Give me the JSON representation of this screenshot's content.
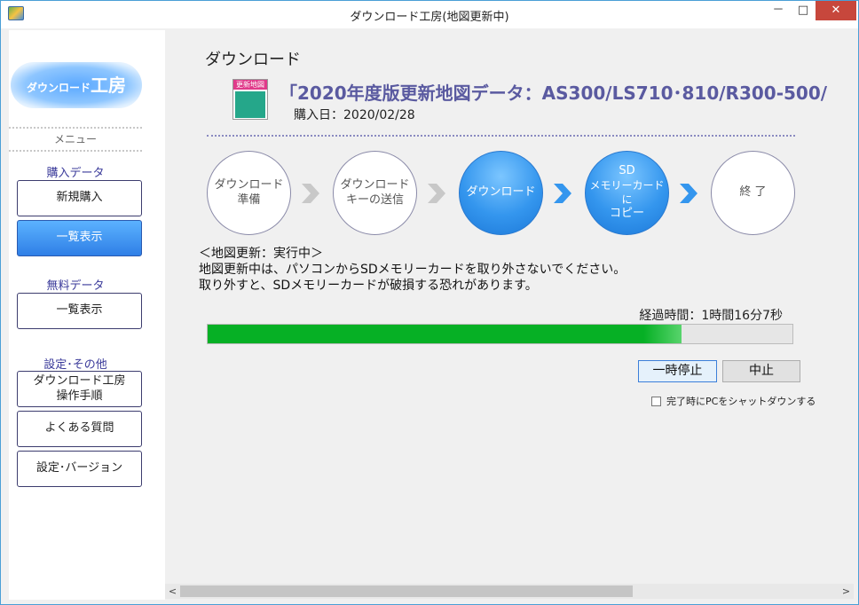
{
  "window": {
    "title": "ダウンロード工房(地図更新中)",
    "controls": {
      "minimize": "－",
      "maximize": "□",
      "close": "✕"
    }
  },
  "sidebar": {
    "logo_small": "ダウンロード",
    "logo_big": "工房",
    "menu_heading": "メニュー",
    "sections": {
      "purchased": "購入データ",
      "free": "無料データ",
      "settings": "設定･その他"
    },
    "buttons": {
      "new_purchase": "新規購入",
      "list_view_purchased": "一覧表示",
      "list_view_free": "一覧表示",
      "manual_line1": "ダウンロード工房",
      "manual_line2": "操作手順",
      "faq": "よくある質問",
      "settings_version": "設定･バージョン"
    }
  },
  "main": {
    "heading": "ダウンロード",
    "product_icon_label": "更新地図",
    "product_title": "「2020年度版更新地図データ：AS300/LS710･810/R300-500/",
    "purchase_date": "購入日：2020/02/28",
    "steps": [
      {
        "line1": "ダウンロード",
        "line2": "準備"
      },
      {
        "line1": "ダウンロード",
        "line2": "キーの送信"
      },
      {
        "line1": "ダウンロード",
        "line2": ""
      },
      {
        "line1": "SD",
        "line2": "メモリーカードに",
        "line3": "コピー"
      },
      {
        "line1": "終 了",
        "line2": ""
      }
    ],
    "status_heading": "＜地図更新：実行中＞",
    "status_line1": "地図更新中は、パソコンからSDメモリーカードを取り外さないでください。",
    "status_line2": "取り外すと、SDメモリーカードが破損する恐れがあります。",
    "elapsed": "経過時間：1時間16分7秒",
    "progress_percent": 81,
    "pause_button": "一時停止",
    "cancel_button": "中止",
    "shutdown_checkbox_label": "完了時にPCをシャットダウンする",
    "shutdown_checked": false
  },
  "scrollbar": {
    "left": "<",
    "right": ">"
  },
  "colors": {
    "active_step": "#3496ee",
    "progress": "#06b025",
    "accent_text": "#5a5aa0",
    "close_button": "#c7473c"
  }
}
